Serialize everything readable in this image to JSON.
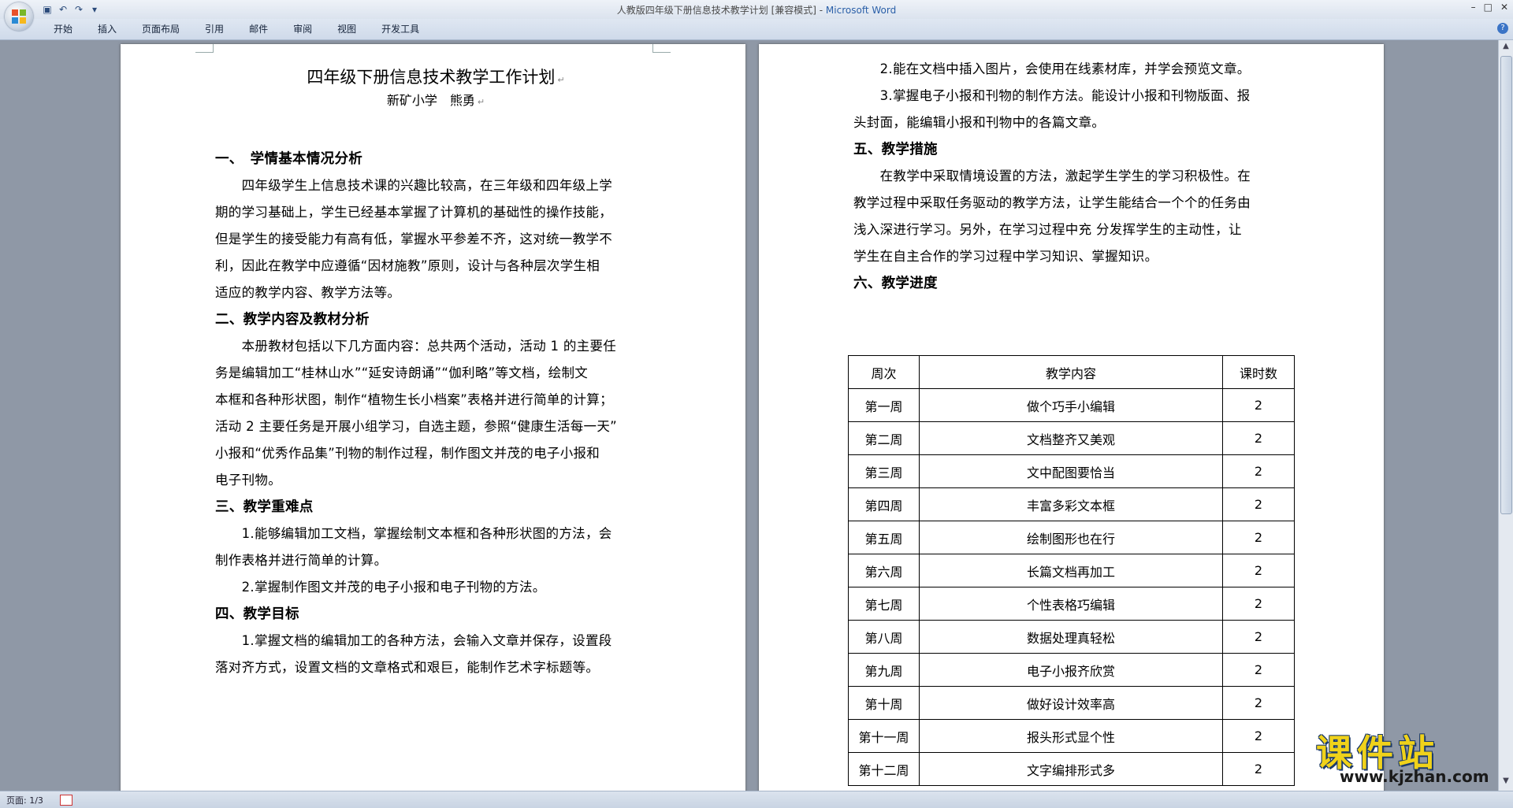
{
  "window": {
    "doc_name": "人教版四年级下册信息技术教学计划 [兼容模式] - ",
    "app_name": "Microsoft Word"
  },
  "ribbon": {
    "tabs": [
      "开始",
      "插入",
      "页面布局",
      "引用",
      "邮件",
      "审阅",
      "视图",
      "开发工具"
    ]
  },
  "left_page": {
    "title": "四年级下册信息技术教学工作计划",
    "author": "新矿小学　熊勇",
    "lines": [
      {
        "text": "一、　学情基本情况分析",
        "heading": true
      },
      {
        "text": "　　四年级学生上信息技术课的兴趣比较高，在三年级和四年级上学",
        "heading": false
      },
      {
        "text": "期的学习基础上，学生已经基本掌握了计算机的基础性的操作技能，",
        "heading": false
      },
      {
        "text": "但是学生的接受能力有高有低，掌握水平参差不齐，这对统一教学不",
        "heading": false
      },
      {
        "text": "利，因此在教学中应遵循“因材施教”原则，设计与各种层次学生相",
        "heading": false
      },
      {
        "text": "适应的教学内容、教学方法等。",
        "heading": false
      },
      {
        "text": "二、教学内容及教材分析",
        "heading": true
      },
      {
        "text": "　　本册教材包括以下几方面内容：总共两个活动，活动 1 的主要任",
        "heading": false
      },
      {
        "text": "务是编辑加工“桂林山水”“延安诗朗诵”“伽利略”等文档，绘制文",
        "heading": false
      },
      {
        "text": "本框和各种形状图，制作“植物生长小档案”表格并进行简单的计算；",
        "heading": false
      },
      {
        "text": "活动 2 主要任务是开展小组学习，自选主题，参照“健康生活每一天”",
        "heading": false
      },
      {
        "text": "小报和“优秀作品集”刊物的制作过程，制作图文并茂的电子小报和",
        "heading": false
      },
      {
        "text": "电子刊物。",
        "heading": false
      },
      {
        "text": "三、教学重难点",
        "heading": true
      },
      {
        "text": "　　1.能够编辑加工文档，掌握绘制文本框和各种形状图的方法，会",
        "heading": false
      },
      {
        "text": "制作表格并进行简单的计算。",
        "heading": false
      },
      {
        "text": "　　2.掌握制作图文并茂的电子小报和电子刊物的方法。",
        "heading": false
      },
      {
        "text": "四、教学目标",
        "heading": true
      },
      {
        "text": "　　1.掌握文档的编辑加工的各种方法，会输入文章并保存，设置段",
        "heading": false
      },
      {
        "text": "落对齐方式，设置文档的文章格式和艰巨，能制作艺术字标题等。",
        "heading": false
      }
    ]
  },
  "right_page": {
    "lines": [
      {
        "text": "　　2.能在文档中插入图片，会使用在线素材库，并学会预览文章。",
        "heading": false
      },
      {
        "text": "　　3.掌握电子小报和刊物的制作方法。能设计小报和刊物版面、报",
        "heading": false
      },
      {
        "text": "头封面，能编辑小报和刊物中的各篇文章。",
        "heading": false
      },
      {
        "text": "五、教学措施",
        "heading": true
      },
      {
        "text": "　　在教学中采取情境设置的方法，激起学生学生的学习积极性。在",
        "heading": false
      },
      {
        "text": "教学过程中采取任务驱动的教学方法，让学生能结合一个个的任务由",
        "heading": false
      },
      {
        "text": "浅入深进行学习。另外，在学习过程中充 分发挥学生的主动性，让",
        "heading": false
      },
      {
        "text": "学生在自主合作的学习过程中学习知识、掌握知识。",
        "heading": false
      },
      {
        "text": "六、教学进度",
        "heading": true
      }
    ],
    "table": {
      "headers": [
        "周次",
        "教学内容",
        "课时数"
      ],
      "rows": [
        [
          "第一周",
          "做个巧手小编辑",
          "2"
        ],
        [
          "第二周",
          "文档整齐又美观",
          "2"
        ],
        [
          "第三周",
          "文中配图要恰当",
          "2"
        ],
        [
          "第四周",
          "丰富多彩文本框",
          "2"
        ],
        [
          "第五周",
          "绘制图形也在行",
          "2"
        ],
        [
          "第六周",
          "长篇文档再加工",
          "2"
        ],
        [
          "第七周",
          "个性表格巧编辑",
          "2"
        ],
        [
          "第八周",
          "数据处理真轻松",
          "2"
        ],
        [
          "第九周",
          "电子小报齐欣赏",
          "2"
        ],
        [
          "第十周",
          "做好设计效率高",
          "2"
        ],
        [
          "第十一周",
          "报头形式显个性",
          "2"
        ],
        [
          "第十二周",
          "文字编排形式多",
          "2"
        ]
      ]
    }
  },
  "status": {
    "page": "页面: 1/3"
  },
  "watermark": {
    "title": "课件站",
    "url": "www.kjzhan.com"
  },
  "icons": {
    "office_button": "office-logo-icon",
    "save": "save-icon",
    "undo": "undo-icon",
    "redo": "redo-icon",
    "customize": "qat-dropdown-icon",
    "help": "help-icon"
  }
}
